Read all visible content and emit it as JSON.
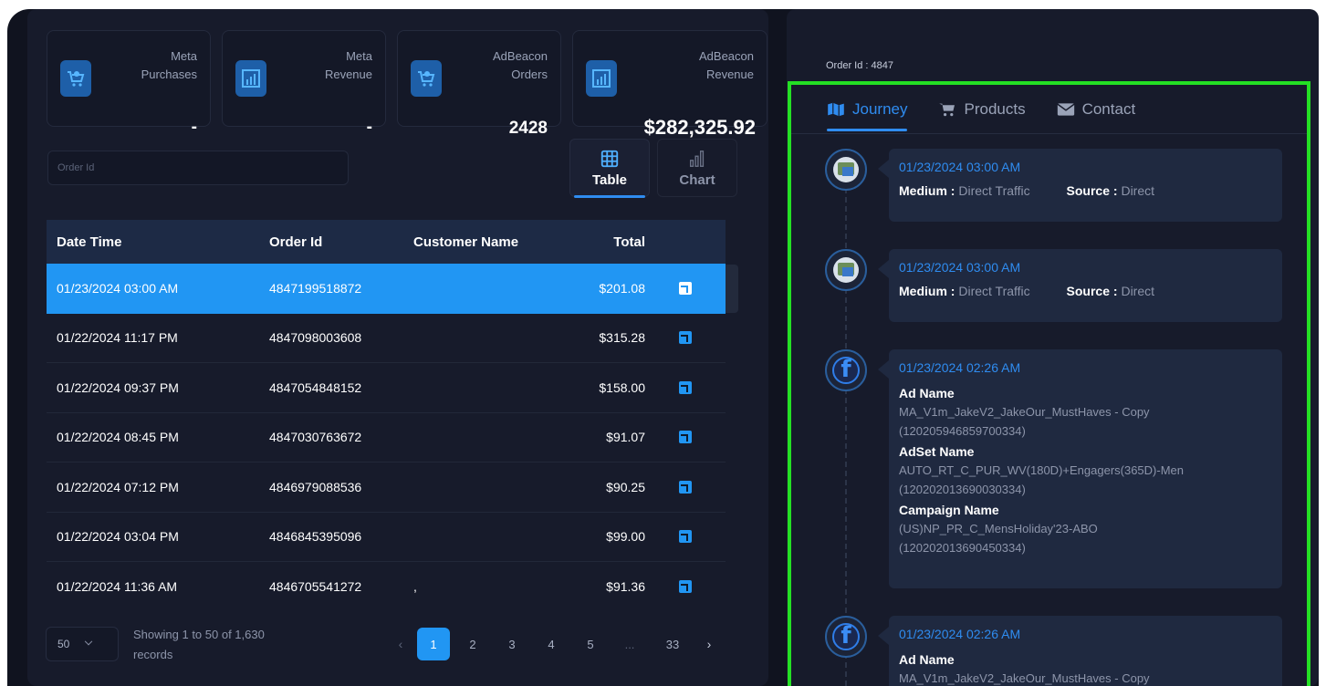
{
  "stats": [
    {
      "label_line1": "Meta",
      "label_line2": "Purchases",
      "value": "-",
      "icon": "cart-icon"
    },
    {
      "label_line1": "Meta",
      "label_line2": "Revenue",
      "value": "-",
      "icon": "revenue-chart-icon"
    },
    {
      "label_line1": "AdBeacon",
      "label_line2": "Orders",
      "value": "2428",
      "icon": "cart-icon"
    },
    {
      "label_line1": "AdBeacon",
      "label_line2": "Revenue",
      "value": "$282,325.92",
      "icon": "revenue-chart-icon"
    }
  ],
  "search": {
    "placeholder": "Order Id"
  },
  "view_toggle": {
    "table_label": "Table",
    "chart_label": "Chart",
    "active": "Table"
  },
  "table": {
    "headers": [
      "Date Time",
      "Order Id",
      "Customer Name",
      "Total"
    ],
    "rows": [
      {
        "datetime": "01/23/2024 03:00 AM",
        "order_id": "4847199518872",
        "customer": "",
        "total": "$201.08",
        "selected": true
      },
      {
        "datetime": "01/22/2024 11:17 PM",
        "order_id": "4847098003608",
        "customer": "",
        "total": "$315.28"
      },
      {
        "datetime": "01/22/2024 09:37 PM",
        "order_id": "4847054848152",
        "customer": "",
        "total": "$158.00"
      },
      {
        "datetime": "01/22/2024 08:45 PM",
        "order_id": "4847030763672",
        "customer": "",
        "total": "$91.07"
      },
      {
        "datetime": "01/22/2024 07:12 PM",
        "order_id": "4846979088536",
        "customer": "",
        "total": "$90.25"
      },
      {
        "datetime": "01/22/2024 03:04 PM",
        "order_id": "4846845395096",
        "customer": "",
        "total": "$99.00"
      },
      {
        "datetime": "01/22/2024 11:36 AM",
        "order_id": "4846705541272",
        "customer": ",",
        "total": "$91.36"
      }
    ]
  },
  "footer": {
    "page_size": "50",
    "showing_line1": "Showing 1 to 50 of 1,630",
    "showing_line2": "records",
    "pages": [
      "1",
      "2",
      "3",
      "4",
      "5",
      "...",
      "33"
    ],
    "prev": "‹",
    "next": "›",
    "current_page": "1"
  },
  "detail": {
    "order_id_label": "Order Id : 4847",
    "tabs": [
      {
        "label": "Journey",
        "icon": "map-icon",
        "active": true
      },
      {
        "label": "Products",
        "icon": "cart-icon"
      },
      {
        "label": "Contact",
        "icon": "envelope-icon"
      }
    ],
    "events": [
      {
        "type": "web",
        "timestamp": "01/23/2024 03:00 AM",
        "medium_label": "Medium :",
        "medium": "Direct Traffic",
        "source_label": "Source :",
        "source": "Direct"
      },
      {
        "type": "web",
        "timestamp": "01/23/2024 03:00 AM",
        "medium_label": "Medium :",
        "medium": "Direct Traffic",
        "source_label": "Source :",
        "source": "Direct"
      },
      {
        "type": "facebook",
        "timestamp": "01/23/2024 02:26 AM",
        "ad_name_label": "Ad Name",
        "ad_name": "MA_V1m_JakeV2_JakeOur_MustHaves - Copy",
        "ad_id": "(120205946859700334)",
        "adset_label": "AdSet Name",
        "adset_name": "AUTO_RT_C_PUR_WV(180D)+Engagers(365D)-Men",
        "adset_id": "(120202013690030334)",
        "campaign_label": "Campaign Name",
        "campaign_name": "(US)NP_PR_C_MensHoliday'23-ABO",
        "campaign_id": "(120202013690450334)"
      },
      {
        "type": "facebook",
        "timestamp": "01/23/2024 02:26 AM",
        "ad_name_label": "Ad Name",
        "ad_name": "MA_V1m_JakeV2_JakeOur_MustHaves - Copy"
      }
    ]
  },
  "colors": {
    "accent": "#2196f3",
    "highlight_border": "#24e024",
    "background": "#10131f",
    "panel": "#171b2b"
  }
}
